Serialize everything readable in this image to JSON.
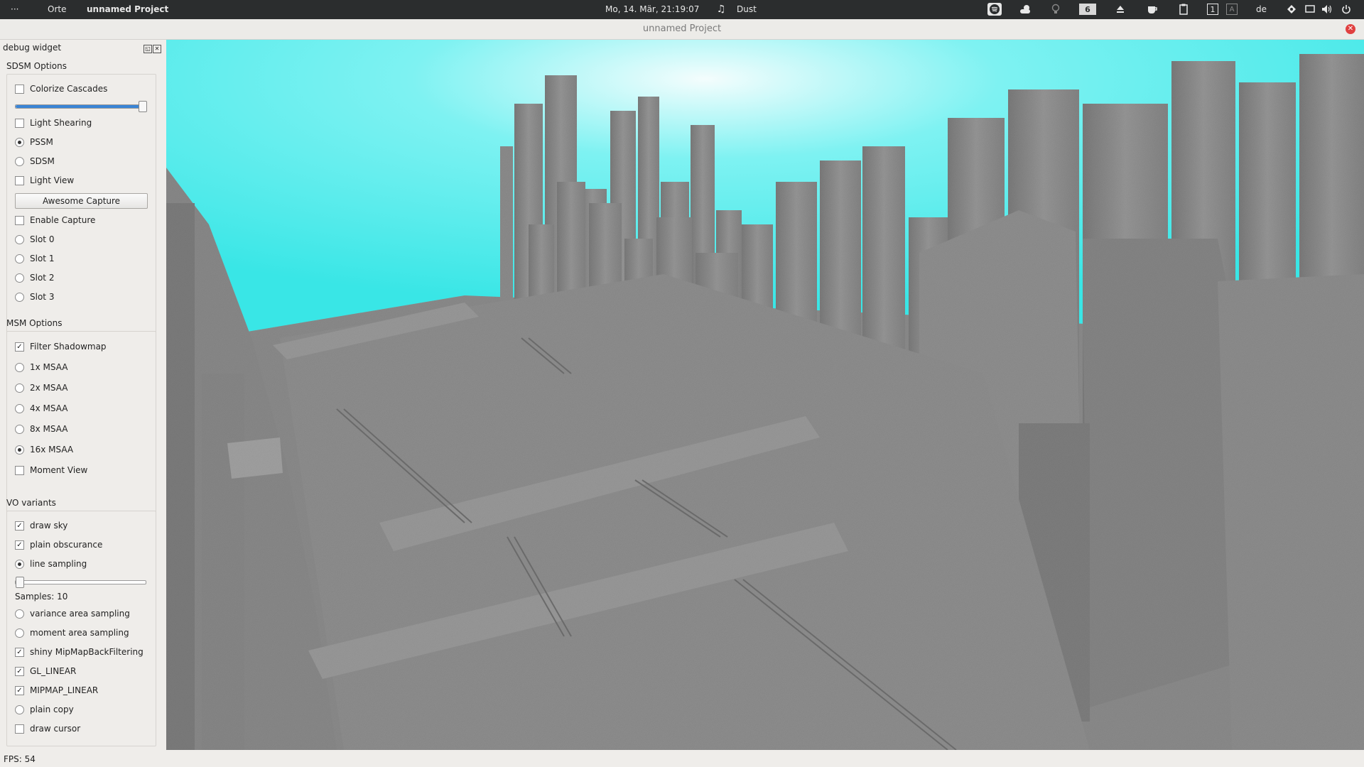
{
  "topbar": {
    "menu_dots": "···",
    "places": "Orte",
    "app_name": "unnamed Project",
    "datetime": "Mo, 14. Mär, 21:19:07",
    "music_title": "Dust",
    "workspace_number": "6",
    "desktop_number": "1",
    "keyboard_layout": "de"
  },
  "window": {
    "title": "unnamed Project"
  },
  "sidebar": {
    "dock_title": "debug widget",
    "sdsm": {
      "title": "SDSM Options",
      "colorize_cascades": {
        "label": "Colorize Cascades",
        "checked": false
      },
      "slider_value": 1.0,
      "light_shearing": {
        "label": "Light Shearing",
        "checked": false
      },
      "pssm": {
        "label": "PSSM",
        "checked": true
      },
      "sdsm_option": {
        "label": "SDSM",
        "checked": false
      },
      "light_view": {
        "label": "Light View",
        "checked": false
      },
      "awesome_capture": "Awesome Capture",
      "enable_capture": {
        "label": "Enable Capture",
        "checked": false
      },
      "slot0": "Slot 0",
      "slot1": "Slot 1",
      "slot2": "Slot 2",
      "slot3": "Slot 3"
    },
    "msm": {
      "title": "MSM Options",
      "filter_shadowmap": {
        "label": "Filter Shadowmap",
        "checked": true
      },
      "msaa1": "1x MSAA",
      "msaa2": "2x MSAA",
      "msaa4": "4x MSAA",
      "msaa8": "8x MSAA",
      "msaa16": "16x MSAA",
      "msaa_selected": "16x MSAA",
      "moment_view": {
        "label": "Moment View",
        "checked": false
      }
    },
    "vo": {
      "title": "VO variants",
      "draw_sky": {
        "label": "draw sky",
        "checked": true
      },
      "plain_obscurance": {
        "label": "plain obscurance",
        "checked": true
      },
      "line_sampling": {
        "label": "line sampling",
        "checked": true
      },
      "samples_slider_value": 0.0,
      "samples_label": "Samples: 10",
      "variance_area_sampling": "variance area sampling",
      "moment_area_sampling": "moment area sampling",
      "shiny_mipmap": {
        "label": "shiny MipMapBackFiltering",
        "checked": true
      },
      "gl_linear": {
        "label": "GL_LINEAR",
        "checked": true
      },
      "mipmap_linear": {
        "label": "MIPMAP_LINEAR",
        "checked": true
      },
      "plain_copy": "plain copy",
      "draw_cursor": {
        "label": "draw cursor",
        "checked": false
      }
    }
  },
  "status": {
    "fps": "FPS: 54"
  },
  "colors": {
    "topbar_bg": "#2b2d2e",
    "sky": "#39e6e6",
    "geometry": "#8a8a8a",
    "slider_fill": "#3a85d6",
    "close_button": "#e04040"
  }
}
